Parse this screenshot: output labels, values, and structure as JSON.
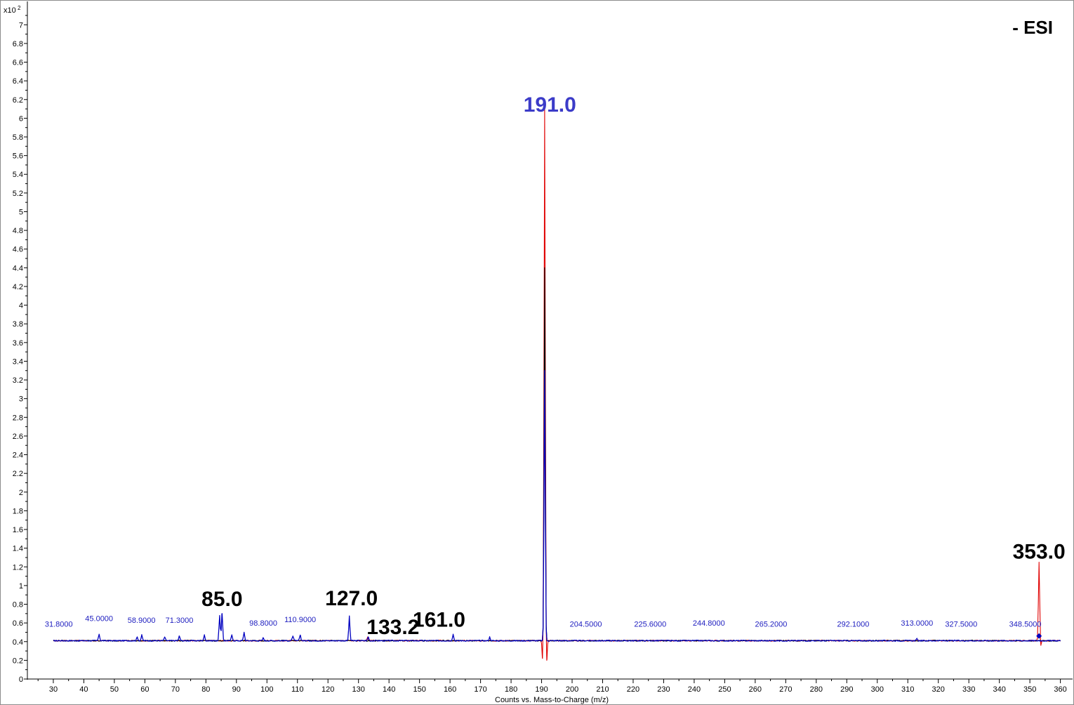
{
  "chart_data": {
    "type": "line",
    "y_scale_label": "x10",
    "y_scale_exponent": "2",
    "xlabel": "Counts vs. Mass-to-Charge (m/z)",
    "mode_label": "- ESI",
    "xlim": [
      21.5,
      364
    ],
    "ylim": [
      0,
      7.25
    ],
    "x_ticks": [
      30,
      40,
      50,
      60,
      70,
      80,
      90,
      100,
      110,
      120,
      130,
      140,
      150,
      160,
      170,
      180,
      190,
      200,
      210,
      220,
      230,
      240,
      250,
      260,
      270,
      280,
      290,
      300,
      310,
      320,
      330,
      340,
      350,
      360
    ],
    "x_tick_labels": [
      "30",
      "40",
      "50",
      "60",
      "70",
      "80",
      "90",
      "100",
      "110",
      "120",
      "130",
      "140",
      "150",
      "160",
      "170",
      "180",
      "190",
      "200",
      "210",
      "220",
      "230",
      "240",
      "250",
      "260",
      "270",
      "280",
      "290",
      "300",
      "310",
      "320",
      "330",
      "340",
      "350",
      "360"
    ],
    "y_ticks": [
      0,
      0.2,
      0.4,
      0.6,
      0.8,
      1,
      1.2,
      1.4,
      1.6,
      1.8,
      2,
      2.2,
      2.4,
      2.6,
      2.8,
      3,
      3.2,
      3.4,
      3.6,
      3.8,
      4,
      4.2,
      4.4,
      4.6,
      4.8,
      5,
      5.2,
      5.4,
      5.6,
      5.8,
      6,
      6.2,
      6.4,
      6.6,
      6.8,
      7
    ],
    "y_tick_labels": [
      "0",
      "0.2",
      "0.4",
      "0.6",
      "0.8",
      "1",
      "1.2",
      "1.4",
      "1.6",
      "1.8",
      "2",
      "2.2",
      "2.4",
      "2.6",
      "2.8",
      "3",
      "3.2",
      "3.4",
      "3.6",
      "3.8",
      "4",
      "4.2",
      "4.4",
      "4.6",
      "4.8",
      "5",
      "5.2",
      "5.4",
      "5.6",
      "5.8",
      "6",
      "6.2",
      "6.4",
      "6.6",
      "6.8",
      "7"
    ],
    "baseline": 0.41,
    "series": [
      {
        "color": "#0000c0",
        "peaks": [
          {
            "x": 45.0,
            "y": 0.48
          },
          {
            "x": 57.5,
            "y": 0.45
          },
          {
            "x": 59.0,
            "y": 0.47
          },
          {
            "x": 66.5,
            "y": 0.45
          },
          {
            "x": 71.3,
            "y": 0.46
          },
          {
            "x": 79.5,
            "y": 0.47
          },
          {
            "x": 84.5,
            "y": 0.68
          },
          {
            "x": 85.3,
            "y": 0.7
          },
          {
            "x": 88.5,
            "y": 0.47
          },
          {
            "x": 92.5,
            "y": 0.5
          },
          {
            "x": 98.8,
            "y": 0.44
          },
          {
            "x": 108.5,
            "y": 0.46
          },
          {
            "x": 110.9,
            "y": 0.47
          },
          {
            "x": 127.0,
            "y": 0.67
          },
          {
            "x": 133.2,
            "y": 0.45
          },
          {
            "x": 161.0,
            "y": 0.48
          },
          {
            "x": 173.0,
            "y": 0.45
          },
          {
            "x": 191.0,
            "y": 3.3
          },
          {
            "x": 313.0,
            "y": 0.43
          }
        ]
      },
      {
        "color": "#e00000",
        "peaks": [
          {
            "x": 191.0,
            "y": 6.1
          },
          {
            "x": 353.0,
            "y": 1.25
          },
          {
            "x": 133.0,
            "y": 0.45
          }
        ],
        "dips": [
          {
            "x": 190.3,
            "y": 0.22
          },
          {
            "x": 191.7,
            "y": 0.2
          },
          {
            "x": 353.6,
            "y": 0.36
          }
        ]
      },
      {
        "color": "#000000",
        "peaks": [
          {
            "x": 191.0,
            "y": 4.4
          }
        ]
      }
    ],
    "small_labels": [
      {
        "text": "31.8000",
        "x": 31.8,
        "y": 0.56
      },
      {
        "text": "45.0000",
        "x": 45.0,
        "y": 0.62
      },
      {
        "text": "58.9000",
        "x": 58.9,
        "y": 0.6
      },
      {
        "text": "71.3000",
        "x": 71.3,
        "y": 0.6
      },
      {
        "text": "98.8000",
        "x": 98.8,
        "y": 0.57
      },
      {
        "text": "110.9000",
        "x": 110.9,
        "y": 0.61
      },
      {
        "text": "204.5000",
        "x": 204.5,
        "y": 0.56
      },
      {
        "text": "225.6000",
        "x": 225.6,
        "y": 0.56
      },
      {
        "text": "244.8000",
        "x": 244.8,
        "y": 0.57
      },
      {
        "text": "265.2000",
        "x": 265.2,
        "y": 0.56
      },
      {
        "text": "292.1000",
        "x": 292.1,
        "y": 0.56
      },
      {
        "text": "313.0000",
        "x": 313.0,
        "y": 0.57
      },
      {
        "text": "327.5000",
        "x": 327.5,
        "y": 0.56
      },
      {
        "text": "348.5000",
        "x": 348.5,
        "y": 0.56
      }
    ],
    "big_labels": [
      {
        "text": "85.0",
        "x": 85.3,
        "y": 0.78
      },
      {
        "text": "127.0",
        "x": 127.7,
        "y": 0.79
      },
      {
        "text": "133.2",
        "x": 141.3,
        "y": 0.48
      },
      {
        "text": "161.0",
        "x": 156.4,
        "y": 0.56
      },
      {
        "text": "191.0",
        "x": 192.7,
        "y": 6.07,
        "accent": "blue"
      },
      {
        "text": "353.0",
        "x": 353.0,
        "y": 1.29
      }
    ],
    "marker": {
      "x": 353.0,
      "y": 0.46,
      "color": "#0000c0"
    }
  }
}
